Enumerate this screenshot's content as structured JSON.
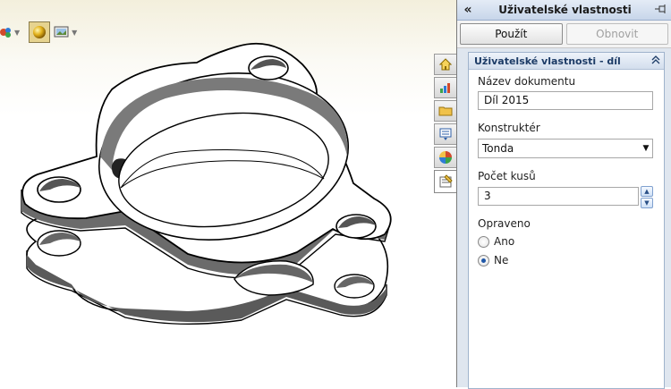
{
  "taskpane": {
    "collapse_icon": "double-chevron-left",
    "title": "Uživatelské vlastnosti",
    "pin_icon": "pin-icon",
    "apply_label": "Použít",
    "refresh_label": "Obnovit"
  },
  "group": {
    "title": "Uživatelské vlastnosti - díl",
    "collapse_icon": "double-chevron-up"
  },
  "fields": {
    "doc_name_label": "Název dokumentu",
    "doc_name_value": "Díl 2015",
    "designer_label": "Konstruktér",
    "designer_value": "Tonda",
    "count_label": "Počet kusů",
    "count_value": "3",
    "fixed_label": "Opraveno",
    "option_yes": "Ano",
    "option_no": "Ne",
    "selected_option": "Ne"
  },
  "tabs": [
    {
      "name": "home-tab",
      "icon": "house-icon"
    },
    {
      "name": "resources-tab",
      "icon": "chart-icon"
    },
    {
      "name": "file-explorer-tab",
      "icon": "folder-icon"
    },
    {
      "name": "view-palette-tab",
      "icon": "palette-icon"
    },
    {
      "name": "appearances-tab",
      "icon": "color-sphere-icon"
    },
    {
      "name": "custom-properties-tab",
      "icon": "properties-icon",
      "active": true
    }
  ],
  "colors": {
    "accent": "#1c3b66",
    "header_bg": "#c7d6ea",
    "pane_bg": "#dfe6ef"
  }
}
